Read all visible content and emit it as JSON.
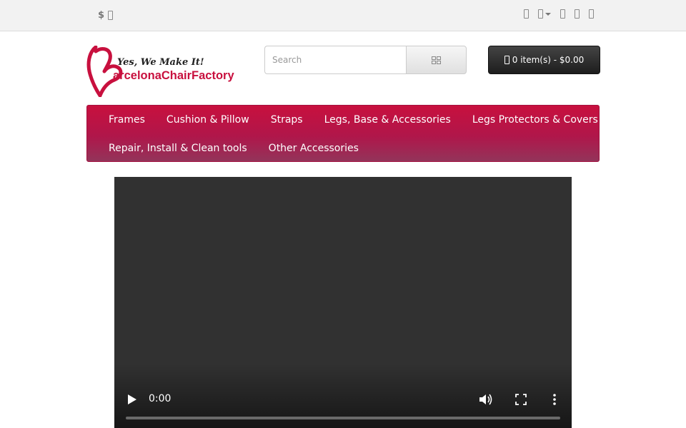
{
  "topbar": {
    "currency_symbol": "$",
    "icons": [
      "phone-icon",
      "user-icon",
      "heart-icon",
      "cart-icon",
      "share-icon"
    ]
  },
  "logo": {
    "tagline": "Yes, We Make It!",
    "brand": "BarcelonaChairFactory",
    "brand_rest": "arcelonaChairFactory",
    "color": "#c8103e"
  },
  "search": {
    "placeholder": "Search"
  },
  "cart": {
    "label": "0 item(s) - $0.00"
  },
  "menu": {
    "row1": [
      "Frames",
      "Cushion & Pillow",
      "Straps",
      "Legs, Base & Accessories",
      "Legs Protectors & Covers"
    ],
    "row2": [
      "Repair, Install & Clean tools",
      "Other Accessories"
    ],
    "accent": "#c8103e"
  },
  "video": {
    "time": "0:00",
    "progress": 0
  }
}
